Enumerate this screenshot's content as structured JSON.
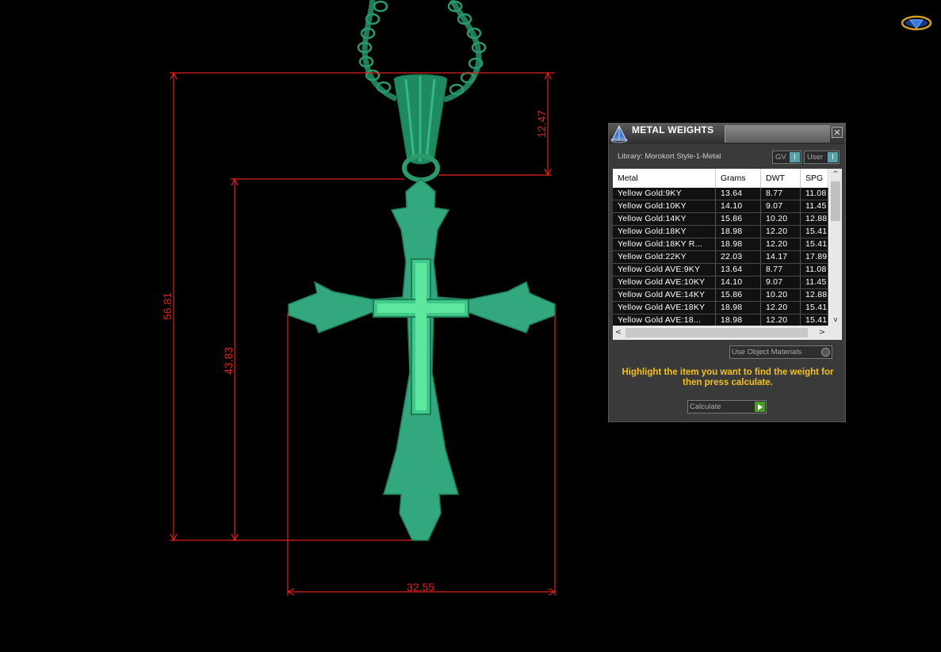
{
  "dimensions": {
    "overall_height": "56.81",
    "bail_height": "12.47",
    "cross_height": "43.83",
    "cross_width": "32.55"
  },
  "colors": {
    "background": "#000000",
    "dimension_lines": "#e02020",
    "model": "#2fa27a",
    "hint_text": "#f2c020"
  },
  "icons": {
    "logo": "gemvision-logo-icon",
    "panel": "pyramid-icon",
    "close": "close-icon",
    "calculate": "play-arrow-icon"
  },
  "panel": {
    "title": "METAL WEIGHTS",
    "close_label": "✕",
    "library_label": "Library: Morokort Style-1-Metal",
    "toggle_gv": "GV",
    "toggle_user": "User",
    "toggle_btn": "I",
    "use_object_materials": "Use Object Materials",
    "hint": "Highlight the item you want to find the weight for then press calculate.",
    "calculate_label": "Calculate",
    "table": {
      "columns": [
        "Metal",
        "Grams",
        "DWT",
        "SPG"
      ],
      "rows": [
        [
          "Yellow Gold:9KY",
          "13.64",
          "8.77",
          "11.08"
        ],
        [
          "Yellow Gold:10KY",
          "14.10",
          "9.07",
          "11.45"
        ],
        [
          "Yellow Gold:14KY",
          "15.86",
          "10.20",
          "12.88"
        ],
        [
          "Yellow Gold:18KY",
          "18.98",
          "12.20",
          "15.41"
        ],
        [
          "Yellow Gold:18KY R...",
          "18.98",
          "12.20",
          "15.41"
        ],
        [
          "Yellow Gold:22KY",
          "22.03",
          "14.17",
          "17.89"
        ],
        [
          "Yellow Gold AVE:9KY",
          "13.64",
          "8.77",
          "11.08"
        ],
        [
          "Yellow Gold AVE:10KY",
          "14.10",
          "9.07",
          "11.45"
        ],
        [
          "Yellow Gold AVE:14KY",
          "15.86",
          "10.20",
          "12.88"
        ],
        [
          "Yellow Gold AVE:18KY",
          "18.98",
          "12.20",
          "15.41"
        ],
        [
          "Yellow Gold AVE:18...",
          "18.98",
          "12.20",
          "15.41"
        ]
      ]
    },
    "scroll": {
      "up": "^",
      "down": "v",
      "left": "<",
      "right": ">"
    }
  }
}
